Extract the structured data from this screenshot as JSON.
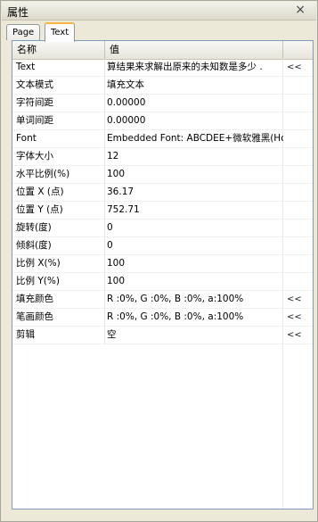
{
  "window": {
    "title": "属性",
    "close_symbol": "×"
  },
  "tabs": [
    {
      "label": "Page"
    },
    {
      "label": "Text"
    }
  ],
  "table": {
    "headers": [
      "名称",
      "值",
      ""
    ],
    "rows": [
      {
        "name": "Text",
        "value": "算结果来求解出原来的未知数是多少 .",
        "action": "<<"
      },
      {
        "name": "文本模式",
        "value": "填充文本",
        "action": ""
      },
      {
        "name": "字符间距",
        "value": "0.00000",
        "action": ""
      },
      {
        "name": "单词间距",
        "value": "0.00000",
        "action": ""
      },
      {
        "name": "Font",
        "value": "Embedded Font: ABCDEE+微软雅黑(Hor",
        "action": ""
      },
      {
        "name": "字体大小",
        "value": "12",
        "action": ""
      },
      {
        "name": "水平比例(%)",
        "value": "100",
        "action": ""
      },
      {
        "name": "位置 X (点)",
        "value": "36.17",
        "action": ""
      },
      {
        "name": "位置 Y (点)",
        "value": "752.71",
        "action": ""
      },
      {
        "name": "旋转(度)",
        "value": "0",
        "action": ""
      },
      {
        "name": "倾斜(度)",
        "value": "0",
        "action": ""
      },
      {
        "name": "比例 X(%)",
        "value": "100",
        "action": ""
      },
      {
        "name": "比例 Y(%)",
        "value": "100",
        "action": ""
      },
      {
        "name": "填充颜色",
        "value": "R :0%, G :0%, B :0%, a:100%",
        "action": "<<"
      },
      {
        "name": "笔画颜色",
        "value": "R :0%, G :0%, B :0%, a:100%",
        "action": "<<"
      },
      {
        "name": "剪辑",
        "value": "空",
        "action": "<<"
      }
    ]
  }
}
